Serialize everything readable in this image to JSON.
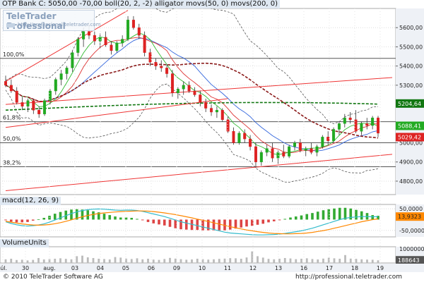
{
  "header": {
    "price_title": "OTP Bank C: 5050,00 -70,00 boll(20, 2, -2) alligator movs(50, 0) movs(200, 0)",
    "macd_title": "macd(12, 26, 9)",
    "volume_title": "VolumeUnits"
  },
  "watermark": {
    "title": "TeleTrader Professional",
    "url": "http://professional.teletrader.com"
  },
  "footer": {
    "copyright": "© 2010 TeleTrader Software AG",
    "url": "http://professional.teletrader.com"
  },
  "colors": {
    "candle_up": "#22aa22",
    "candle_down": "#dd2222",
    "trendline": "#ee3333",
    "ma50": "#8b1a1a",
    "ma200": "#117711",
    "bollinger": "#555555",
    "macd": "#33bbcc",
    "signal": "#ff8800",
    "volume": "#bbbbbb"
  },
  "chart_data": [
    {
      "type": "candlestick",
      "panel": "price",
      "title": "OTP Bank C: 5050,00 -70,00 boll(20, 2, -2) alligator movs(50, 0) movs(200, 0)",
      "x_tick_labels": [
        "júl.",
        "30",
        "aug.",
        "03",
        "04",
        "05",
        "06",
        "09",
        "10",
        "11",
        "12",
        "13",
        "16",
        "17",
        "18",
        "19"
      ],
      "y_tick_labels": [
        "5600,00",
        "5500,00",
        "5400,00",
        "5300,00",
        "5000,00",
        "4900,00",
        "4800,00"
      ],
      "ylim": [
        4730,
        5700
      ],
      "fib_levels": [
        {
          "label": "100,0%",
          "value": 5440
        },
        {
          "label": "61,8%",
          "value": 5110
        },
        {
          "label": "50,0%",
          "value": 5000
        },
        {
          "label": "38,2%",
          "value": 4875
        }
      ],
      "last_values": [
        {
          "label": "5204,64",
          "value": 5204.64
        },
        {
          "label": "5088,41",
          "value": 5088.41
        },
        {
          "label": "5029,42",
          "value": 5029.42
        }
      ],
      "candles": [
        {
          "o": 5320,
          "h": 5350,
          "l": 5290,
          "c": 5300
        },
        {
          "o": 5300,
          "h": 5330,
          "l": 5260,
          "c": 5270
        },
        {
          "o": 5270,
          "h": 5290,
          "l": 5200,
          "c": 5210
        },
        {
          "o": 5210,
          "h": 5240,
          "l": 5170,
          "c": 5190
        },
        {
          "o": 5190,
          "h": 5230,
          "l": 5160,
          "c": 5220
        },
        {
          "o": 5220,
          "h": 5230,
          "l": 5150,
          "c": 5170
        },
        {
          "o": 5170,
          "h": 5190,
          "l": 5130,
          "c": 5150
        },
        {
          "o": 5150,
          "h": 5230,
          "l": 5140,
          "c": 5220
        },
        {
          "o": 5220,
          "h": 5280,
          "l": 5200,
          "c": 5270
        },
        {
          "o": 5270,
          "h": 5340,
          "l": 5250,
          "c": 5330
        },
        {
          "o": 5330,
          "h": 5380,
          "l": 5300,
          "c": 5360
        },
        {
          "o": 5360,
          "h": 5400,
          "l": 5330,
          "c": 5390
        },
        {
          "o": 5390,
          "h": 5480,
          "l": 5370,
          "c": 5470
        },
        {
          "o": 5470,
          "h": 5550,
          "l": 5450,
          "c": 5540
        },
        {
          "o": 5540,
          "h": 5600,
          "l": 5500,
          "c": 5580
        },
        {
          "o": 5580,
          "h": 5620,
          "l": 5540,
          "c": 5560
        },
        {
          "o": 5560,
          "h": 5580,
          "l": 5510,
          "c": 5530
        },
        {
          "o": 5530,
          "h": 5570,
          "l": 5490,
          "c": 5550
        },
        {
          "o": 5550,
          "h": 5580,
          "l": 5500,
          "c": 5510
        },
        {
          "o": 5510,
          "h": 5530,
          "l": 5460,
          "c": 5480
        },
        {
          "o": 5480,
          "h": 5530,
          "l": 5470,
          "c": 5520
        },
        {
          "o": 5520,
          "h": 5560,
          "l": 5500,
          "c": 5540
        },
        {
          "o": 5540,
          "h": 5660,
          "l": 5530,
          "c": 5640
        },
        {
          "o": 5640,
          "h": 5660,
          "l": 5590,
          "c": 5600
        },
        {
          "o": 5600,
          "h": 5620,
          "l": 5540,
          "c": 5560
        },
        {
          "o": 5560,
          "h": 5580,
          "l": 5450,
          "c": 5470
        },
        {
          "o": 5470,
          "h": 5490,
          "l": 5400,
          "c": 5420
        },
        {
          "o": 5420,
          "h": 5440,
          "l": 5380,
          "c": 5400
        },
        {
          "o": 5400,
          "h": 5430,
          "l": 5370,
          "c": 5390
        },
        {
          "o": 5390,
          "h": 5410,
          "l": 5340,
          "c": 5360
        },
        {
          "o": 5360,
          "h": 5380,
          "l": 5240,
          "c": 5260
        },
        {
          "o": 5260,
          "h": 5290,
          "l": 5230,
          "c": 5280
        },
        {
          "o": 5280,
          "h": 5320,
          "l": 5250,
          "c": 5300
        },
        {
          "o": 5300,
          "h": 5320,
          "l": 5260,
          "c": 5270
        },
        {
          "o": 5270,
          "h": 5290,
          "l": 5240,
          "c": 5250
        },
        {
          "o": 5250,
          "h": 5270,
          "l": 5190,
          "c": 5210
        },
        {
          "o": 5210,
          "h": 5230,
          "l": 5160,
          "c": 5180
        },
        {
          "o": 5180,
          "h": 5200,
          "l": 5140,
          "c": 5160
        },
        {
          "o": 5160,
          "h": 5190,
          "l": 5130,
          "c": 5170
        },
        {
          "o": 5170,
          "h": 5180,
          "l": 5110,
          "c": 5120
        },
        {
          "o": 5120,
          "h": 5140,
          "l": 5050,
          "c": 5060
        },
        {
          "o": 5060,
          "h": 5080,
          "l": 4990,
          "c": 5000
        },
        {
          "o": 5000,
          "h": 5060,
          "l": 4990,
          "c": 5050
        },
        {
          "o": 5050,
          "h": 5070,
          "l": 5000,
          "c": 5020
        },
        {
          "o": 5020,
          "h": 5040,
          "l": 4960,
          "c": 4980
        },
        {
          "o": 4980,
          "h": 5000,
          "l": 4870,
          "c": 4900
        },
        {
          "o": 4900,
          "h": 4960,
          "l": 4880,
          "c": 4950
        },
        {
          "o": 4950,
          "h": 4990,
          "l": 4930,
          "c": 4970
        },
        {
          "o": 4970,
          "h": 5000,
          "l": 4900,
          "c": 4920
        },
        {
          "o": 4920,
          "h": 4960,
          "l": 4890,
          "c": 4950
        },
        {
          "o": 4950,
          "h": 4990,
          "l": 4920,
          "c": 4930
        },
        {
          "o": 4930,
          "h": 4990,
          "l": 4920,
          "c": 4980
        },
        {
          "o": 4980,
          "h": 5010,
          "l": 4960,
          "c": 5000
        },
        {
          "o": 5000,
          "h": 5020,
          "l": 4950,
          "c": 4960
        },
        {
          "o": 4960,
          "h": 4980,
          "l": 4930,
          "c": 4970
        },
        {
          "o": 4970,
          "h": 5000,
          "l": 4940,
          "c": 4950
        },
        {
          "o": 4950,
          "h": 4990,
          "l": 4930,
          "c": 4980
        },
        {
          "o": 4980,
          "h": 5040,
          "l": 4970,
          "c": 5030
        },
        {
          "o": 5030,
          "h": 5060,
          "l": 4990,
          "c": 5010
        },
        {
          "o": 5010,
          "h": 5080,
          "l": 5000,
          "c": 5070
        },
        {
          "o": 5070,
          "h": 5110,
          "l": 5040,
          "c": 5100
        },
        {
          "o": 5100,
          "h": 5150,
          "l": 5080,
          "c": 5130
        },
        {
          "o": 5130,
          "h": 5160,
          "l": 5100,
          "c": 5120
        },
        {
          "o": 5120,
          "h": 5170,
          "l": 5050,
          "c": 5060
        },
        {
          "o": 5060,
          "h": 5110,
          "l": 5040,
          "c": 5100
        },
        {
          "o": 5100,
          "h": 5130,
          "l": 5070,
          "c": 5090
        },
        {
          "o": 5090,
          "h": 5140,
          "l": 5070,
          "c": 5130
        },
        {
          "o": 5130,
          "h": 5140,
          "l": 5030,
          "c": 5050
        }
      ]
    },
    {
      "type": "line",
      "panel": "macd",
      "title": "macd(12, 26, 9)",
      "y_tick_labels": [
        "50,0000",
        "-50,0000"
      ],
      "ylim": [
        -80,
        70
      ],
      "last_value_label": "13,9323",
      "macd": [
        -10,
        -18,
        -24,
        -28,
        -30,
        -28,
        -25,
        -20,
        -12,
        -2,
        8,
        18,
        28,
        36,
        42,
        46,
        48,
        49,
        48,
        46,
        44,
        43,
        44,
        44,
        42,
        38,
        32,
        26,
        20,
        14,
        6,
        -2,
        -10,
        -16,
        -22,
        -28,
        -34,
        -40,
        -46,
        -52,
        -58,
        -62,
        -64,
        -66,
        -68,
        -70,
        -71,
        -71,
        -70,
        -69,
        -67,
        -64,
        -60,
        -56,
        -52,
        -46,
        -40,
        -32,
        -24,
        -16,
        -8,
        0,
        6,
        10,
        12,
        14,
        14,
        13,
        14
      ],
      "signal": [
        -8,
        -12,
        -16,
        -20,
        -23,
        -25,
        -26,
        -25,
        -23,
        -19,
        -14,
        -8,
        -1,
        6,
        13,
        19,
        24,
        28,
        31,
        33,
        35,
        37,
        38,
        39,
        40,
        40,
        39,
        37,
        34,
        31,
        27,
        23,
        18,
        13,
        8,
        2,
        -3,
        -9,
        -15,
        -21,
        -27,
        -33,
        -38,
        -43,
        -48,
        -52,
        -56,
        -59,
        -62,
        -64,
        -65,
        -66,
        -66,
        -65,
        -64,
        -62,
        -59,
        -55,
        -51,
        -46,
        -40,
        -34,
        -28,
        -22,
        -16,
        -10,
        -5,
        0,
        3
      ]
    },
    {
      "type": "bar",
      "panel": "volume",
      "title": "VolumeUnits",
      "y_tick_labels": [
        "1000000",
        "188643"
      ],
      "ylim": [
        0,
        1150000
      ],
      "last_value_label": "188643",
      "values": [
        260000,
        300000,
        210000,
        230000,
        180000,
        220000,
        350000,
        250000,
        280000,
        300000,
        330000,
        290000,
        260000,
        480000,
        520000,
        400000,
        350000,
        300000,
        280000,
        250000,
        420000,
        380000,
        310000,
        280000,
        330000,
        260000,
        300000,
        240000,
        220000,
        280000,
        360000,
        310000,
        270000,
        230000,
        250000,
        300000,
        270000,
        240000,
        260000,
        290000,
        310000,
        340000,
        330000,
        300000,
        390000,
        820000,
        480000,
        380000,
        290000,
        260000,
        300000,
        350000,
        320000,
        270000,
        300000,
        330000,
        280000,
        250000,
        310000,
        370000,
        330000,
        300000,
        560000,
        310000,
        290000,
        260000,
        240000,
        230000,
        188643
      ]
    }
  ]
}
